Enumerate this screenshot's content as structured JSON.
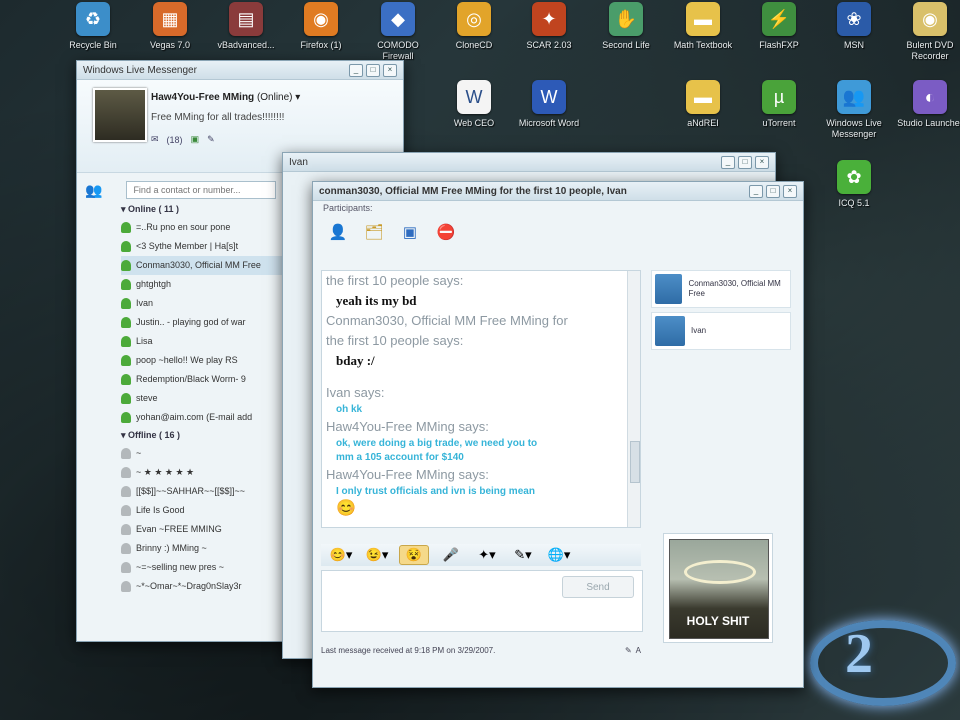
{
  "desktop": {
    "icons": [
      {
        "label": "Recycle Bin",
        "icon": "recycle-bin-icon",
        "color": "#3c8ec9",
        "glyph": "♻"
      },
      {
        "label": "Vegas 7.0",
        "icon": "vegas-icon",
        "color": "#d86a2a",
        "glyph": "▦"
      },
      {
        "label": "vBadvanced...",
        "icon": "vbadvanced-icon",
        "color": "#8a3b3b",
        "glyph": "▤"
      },
      {
        "label": "Firefox (1)",
        "icon": "firefox-icon",
        "color": "#e07b22",
        "glyph": "◉"
      },
      {
        "label": "COMODO Firewall",
        "icon": "comodo-icon",
        "color": "#3b6fc4",
        "glyph": "◆"
      },
      {
        "label": "CloneCD",
        "icon": "clonecd-icon",
        "color": "#e2a42a",
        "glyph": "◎"
      },
      {
        "label": "SCAR 2.03",
        "icon": "scar-icon",
        "color": "#c0441f",
        "glyph": "✦"
      },
      {
        "label": "Second Life",
        "icon": "second-life-icon",
        "color": "#4a9d6a",
        "glyph": "✋"
      },
      {
        "label": "Math Textbook",
        "icon": "folder-icon",
        "color": "#e7c24a",
        "glyph": "▬"
      },
      {
        "label": "FlashFXP",
        "icon": "flashfxp-icon",
        "color": "#3f8f3f",
        "glyph": "⚡"
      },
      {
        "label": "MSN",
        "icon": "msn-icon",
        "color": "#2b5ba8",
        "glyph": "❀"
      },
      {
        "label": "Bulent DVD Recorder",
        "icon": "dvd-recorder-icon",
        "color": "#d9c06a",
        "glyph": "◉"
      },
      {
        "label": "Web CEO",
        "icon": "webceo-icon",
        "color": "#f4f4f4",
        "glyph": "W"
      },
      {
        "label": "Microsoft Word",
        "icon": "word-icon",
        "color": "#2d5ab7",
        "glyph": "W"
      },
      {
        "label": "aNdREI",
        "icon": "folder-icon",
        "color": "#e7c24a",
        "glyph": "▬"
      },
      {
        "label": "uTorrent",
        "icon": "utorrent-icon",
        "color": "#4aa33a",
        "glyph": "µ"
      },
      {
        "label": "Windows Live Messenger",
        "icon": "messenger-icon",
        "color": "#3f9ad8",
        "glyph": "👥"
      },
      {
        "label": "Studio Launcher",
        "icon": "studio-icon",
        "color": "#7b5cc4",
        "glyph": "◐"
      },
      {
        "label": "ICQ 5.1",
        "icon": "icq-icon",
        "color": "#4ab03a",
        "glyph": "✿"
      }
    ]
  },
  "messenger": {
    "title": "Windows Live Messenger",
    "profile_name": "Haw4You-Free MMing",
    "profile_status": "(Online)",
    "personal_message": "Free MMing for all trades!!!!!!!!",
    "mail_count": "(18)",
    "search_placeholder": "Find a contact or number...",
    "online_header": "Online ( 11 )",
    "offline_header": "Offline ( 16 )",
    "online_contacts": [
      "=..Ru pno en sour pone",
      "<3 Sythe Member | Ha[s]t",
      "Conman3030, Official MM Free",
      "ghtghtgh",
      "Ivan",
      "Justin.. - playing god of war",
      "Lisa",
      "poop ~hello!! We play RS",
      "Redemption/Black Worm- 9",
      "steve",
      "yohan@aim.com (E-mail add"
    ],
    "offline_contacts": [
      "~",
      "~ ★ ★ ★ ★ ★",
      "[[$$]]~~SAHHAR~~[[$$]]~~",
      "Life Is Good",
      "Evan ~FREE MMING",
      "Brinny :) MMing ~",
      "~=~selling new pres ~",
      "~*~Omar~*~Drag0nSlay3r"
    ]
  },
  "conversation_back": {
    "title": "Ivan"
  },
  "conversation": {
    "title": "conman3030, Official MM Free MMing for the first 10 people, Ivan",
    "participants_label": "Participants:",
    "history": [
      {
        "kind": "says",
        "text": "the first 10 people says:"
      },
      {
        "kind": "bold",
        "text": "yeah its my bd"
      },
      {
        "kind": "says",
        "text": "Conman3030, Official MM Free MMing for"
      },
      {
        "kind": "says",
        "text": "the first 10 people says:"
      },
      {
        "kind": "bold",
        "text": "bday :/"
      },
      {
        "kind": "blank",
        "text": ""
      },
      {
        "kind": "says",
        "text": "Ivan says:"
      },
      {
        "kind": "cyan",
        "text": "oh kk"
      },
      {
        "kind": "says",
        "text": "Haw4You-Free MMing says:"
      },
      {
        "kind": "cyan",
        "text": "ok, were doing a big trade, we need you to"
      },
      {
        "kind": "cyan",
        "text": "mm a 105 account for $140"
      },
      {
        "kind": "says",
        "text": "Haw4You-Free MMing says:"
      },
      {
        "kind": "cyan",
        "text": "I only trust officials and ivn is being mean"
      },
      {
        "kind": "emoji",
        "text": "😊"
      }
    ],
    "send_label": "Send",
    "status_text": "Last message received at 9:18 PM on 3/29/2007.",
    "participants": [
      {
        "name": "Conman3030, Official MM Free"
      },
      {
        "name": "Ivan"
      }
    ],
    "display_picture_caption": "HOLY SHIT"
  }
}
